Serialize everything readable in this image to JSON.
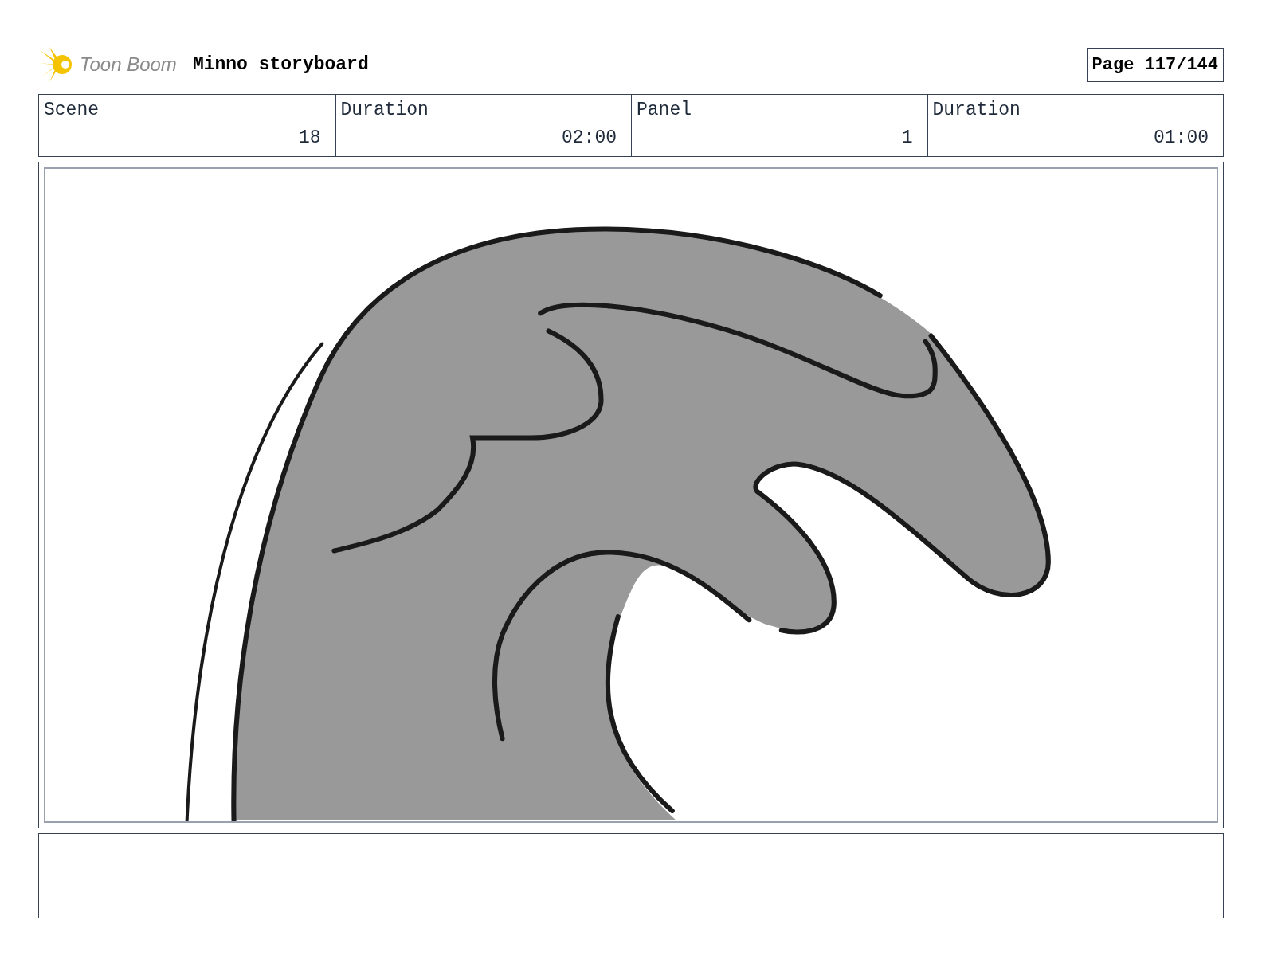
{
  "header": {
    "logo_text": "Toon Boom",
    "title": "Minno storyboard",
    "page": "Page 117/144"
  },
  "fields": [
    {
      "label": "Scene",
      "value": "18"
    },
    {
      "label": "Duration",
      "value": "02:00"
    },
    {
      "label": "Panel",
      "value": "1"
    },
    {
      "label": "Duration",
      "value": "01:00"
    }
  ]
}
